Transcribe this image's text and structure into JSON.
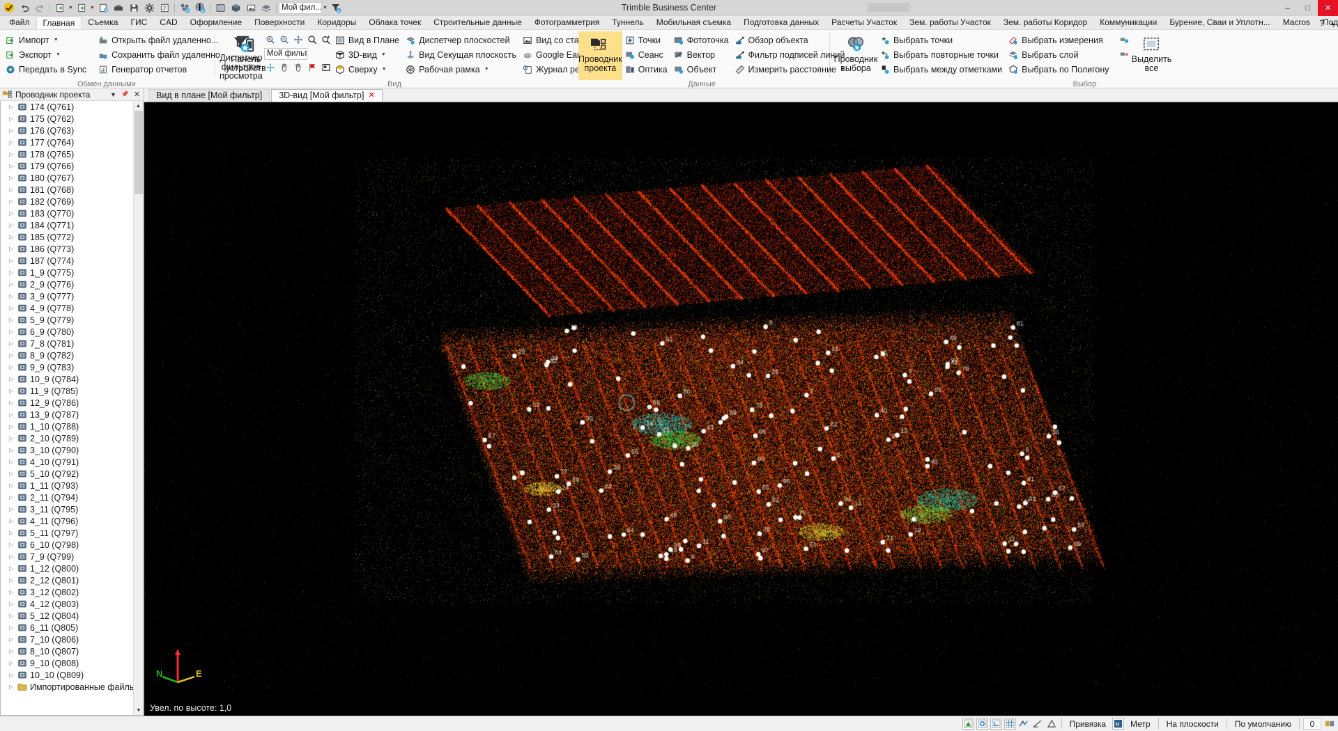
{
  "window": {
    "title": "Trimble Business Center",
    "minimize": "–",
    "maximize": "□",
    "close": "✕"
  },
  "quick_access": {
    "filter_value": "Мой фил...",
    "icons": [
      "trimble-logo-icon",
      "undo-icon",
      "redo-icon",
      "new-project-icon",
      "open-project-icon",
      "save-as-icon",
      "import-icon",
      "save-icon",
      "settings-icon",
      "report-icon",
      "network-icon",
      "globe-icon",
      "window-icon",
      "cube-icon",
      "image-icon",
      "layer-icon"
    ]
  },
  "tabs": {
    "items": [
      {
        "label": "Файл",
        "active": false
      },
      {
        "label": "Главная",
        "active": true
      },
      {
        "label": "Съемка",
        "active": false
      },
      {
        "label": "ГИС",
        "active": false
      },
      {
        "label": "CAD",
        "active": false
      },
      {
        "label": "Оформление",
        "active": false
      },
      {
        "label": "Поверхности",
        "active": false
      },
      {
        "label": "Коридоры",
        "active": false
      },
      {
        "label": "Облака точек",
        "active": false
      },
      {
        "label": "Строительные данные",
        "active": false
      },
      {
        "label": "Фотограмметрия",
        "active": false
      },
      {
        "label": "Туннель",
        "active": false
      },
      {
        "label": "Мобильная съемка",
        "active": false
      },
      {
        "label": "Подготовка данных",
        "active": false
      },
      {
        "label": "Расчеты Участок",
        "active": false
      },
      {
        "label": "Зем. работы Участок",
        "active": false
      },
      {
        "label": "Зем. работы Коридор",
        "active": false
      },
      {
        "label": "Коммуникации",
        "active": false
      },
      {
        "label": "Бурение, Сваи и Уплотн...",
        "active": false
      },
      {
        "label": "Macros",
        "active": false
      },
      {
        "label": "Поддержка",
        "active": false
      }
    ],
    "help_icon": "question-icon",
    "collapse_icon": "chevron-up-icon"
  },
  "ribbon": {
    "groups": [
      {
        "title": "Обмен данными",
        "columns": [
          {
            "items": [
              {
                "label": "Импорт",
                "icon": "import-icon",
                "dropdown": true
              },
              {
                "label": "Экспорт",
                "icon": "export-icon",
                "dropdown": true
              },
              {
                "label": "Передать в Sync",
                "icon": "sync-icon",
                "dropdown": false
              }
            ]
          },
          {
            "items": [
              {
                "label": "Открыть файл удаленно...",
                "icon": "open-remote-icon",
                "dropdown": false
              },
              {
                "label": "Сохранить файл удаленно",
                "icon": "save-remote-icon",
                "dropdown": false
              },
              {
                "label": "Генератор отчетов",
                "icon": "report-generator-icon",
                "dropdown": false
              }
            ]
          }
        ],
        "big_buttons": [
          {
            "label": "Панель устройств",
            "icon": "devices-panel-icon",
            "selected": false
          }
        ]
      },
      {
        "title": "Вид",
        "big_buttons": [
          {
            "label": "Диспетчер фильтров просмотра",
            "icon": "view-filter-manager-icon",
            "selected": false,
            "wide": true
          }
        ],
        "view_tools_row1": [
          "zoom-in-icon",
          "zoom-out-icon",
          "zoom-extents-icon",
          "zoom-window-icon",
          "zoom-selected-icon"
        ],
        "filter_select": {
          "value": "Мой фильтр",
          "icon": "chevron-down-icon"
        },
        "view_tools_row3": [
          "pan-dynamic-icon",
          "pan-hand-icon",
          "orbit-icon",
          "flag-icon",
          "named-view-icon"
        ],
        "columns": [
          {
            "items": [
              {
                "label": "Вид в Плане",
                "icon": "plan-view-icon",
                "dropdown": false
              },
              {
                "label": "3D-вид",
                "icon": "3d-view-icon",
                "dropdown": true
              },
              {
                "label": "Сверху",
                "icon": "top-view-icon",
                "dropdown": true
              }
            ]
          },
          {
            "items": [
              {
                "label": "Диспетчер плоскостей",
                "icon": "plane-manager-icon",
                "dropdown": false
              },
              {
                "label": "Вид Секущая плоскость",
                "icon": "section-view-icon",
                "dropdown": false
              },
              {
                "label": "Рабочая рамка",
                "icon": "work-frame-icon",
                "dropdown": true
              }
            ]
          },
          {
            "items": [
              {
                "label": "Вид со станции",
                "icon": "station-view-icon",
                "dropdown": false
              },
              {
                "label": "Google Earth",
                "icon": "google-earth-icon",
                "dropdown": false
              },
              {
                "label": "Журнал регистрации",
                "icon": "registration-log-icon",
                "dropdown": false
              }
            ]
          }
        ]
      },
      {
        "title": "Данные",
        "big_buttons": [
          {
            "label": "Проводник проекта",
            "icon": "project-explorer-icon",
            "selected": true
          }
        ],
        "columns": [
          {
            "items": [
              {
                "label": "Точки",
                "icon": "points-icon",
                "dropdown": false
              },
              {
                "label": "Сеанс",
                "icon": "session-icon",
                "dropdown": false
              },
              {
                "label": "Оптика",
                "icon": "optics-icon",
                "dropdown": false
              }
            ]
          },
          {
            "items": [
              {
                "label": "Фототочка",
                "icon": "photo-point-icon",
                "dropdown": false
              },
              {
                "label": "Вектор",
                "icon": "vector-icon",
                "dropdown": false
              },
              {
                "label": "Объект",
                "icon": "object-icon",
                "dropdown": false
              }
            ]
          },
          {
            "items": [
              {
                "label": "Обзор объекта",
                "icon": "object-review-icon",
                "dropdown": false
              },
              {
                "label": "Фильтр подписей линий",
                "icon": "line-label-filter-icon",
                "dropdown": false
              },
              {
                "label": "Измерить расстояние",
                "icon": "measure-distance-icon",
                "dropdown": true
              }
            ]
          }
        ]
      },
      {
        "title": "Выбор",
        "big_buttons": [
          {
            "label": "Проводник выбора",
            "icon": "selection-explorer-icon",
            "selected": false
          }
        ],
        "columns": [
          {
            "items": [
              {
                "label": "Выбрать точки",
                "icon": "select-points-icon",
                "dropdown": false
              },
              {
                "label": "Выбрать повторные точки",
                "icon": "select-duplicate-points-icon",
                "dropdown": false
              },
              {
                "label": "Выбрать между отметками",
                "icon": "select-between-marks-icon",
                "dropdown": false
              }
            ]
          },
          {
            "items": [
              {
                "label": "Выбрать измерения",
                "icon": "select-measurements-icon",
                "dropdown": false
              },
              {
                "label": "Выбрать слой",
                "icon": "select-layer-icon",
                "dropdown": false
              },
              {
                "label": "Выбрать по Полигону",
                "icon": "select-by-polygon-icon",
                "dropdown": false
              }
            ]
          }
        ],
        "tail_buttons": [
          {
            "label": "Выделить все",
            "icon": "select-all-icon"
          }
        ],
        "tail_small_icons": [
          "select-group1-icon",
          "select-group2-icon"
        ]
      }
    ]
  },
  "sidebar": {
    "panel_title": "Проводник проекта",
    "dropdown_icon": "chevron-down-icon",
    "pin_icon": "pin-icon",
    "close_icon": "close-icon",
    "panel_icon": "project-explorer-icon",
    "tree_items": [
      {
        "label": "174 (Q761)",
        "icon": "scan-station-icon"
      },
      {
        "label": "175 (Q762)",
        "icon": "scan-station-icon"
      },
      {
        "label": "176 (Q763)",
        "icon": "scan-station-icon"
      },
      {
        "label": "177 (Q764)",
        "icon": "scan-station-icon"
      },
      {
        "label": "178 (Q765)",
        "icon": "scan-station-icon"
      },
      {
        "label": "179 (Q766)",
        "icon": "scan-station-icon"
      },
      {
        "label": "180 (Q767)",
        "icon": "scan-station-icon"
      },
      {
        "label": "181 (Q768)",
        "icon": "scan-station-icon"
      },
      {
        "label": "182 (Q769)",
        "icon": "scan-station-icon"
      },
      {
        "label": "183 (Q770)",
        "icon": "scan-station-icon"
      },
      {
        "label": "184 (Q771)",
        "icon": "scan-station-icon"
      },
      {
        "label": "185 (Q772)",
        "icon": "scan-station-icon"
      },
      {
        "label": "186 (Q773)",
        "icon": "scan-station-icon"
      },
      {
        "label": "187 (Q774)",
        "icon": "scan-station-icon"
      },
      {
        "label": "1_9 (Q775)",
        "icon": "scan-station-icon"
      },
      {
        "label": "2_9 (Q776)",
        "icon": "scan-station-icon"
      },
      {
        "label": "3_9 (Q777)",
        "icon": "scan-station-icon"
      },
      {
        "label": "4_9 (Q778)",
        "icon": "scan-station-icon"
      },
      {
        "label": "5_9 (Q779)",
        "icon": "scan-station-icon"
      },
      {
        "label": "6_9 (Q780)",
        "icon": "scan-station-icon"
      },
      {
        "label": "7_8 (Q781)",
        "icon": "scan-station-icon"
      },
      {
        "label": "8_9 (Q782)",
        "icon": "scan-station-icon"
      },
      {
        "label": "9_9 (Q783)",
        "icon": "scan-station-icon"
      },
      {
        "label": "10_9 (Q784)",
        "icon": "scan-station-icon"
      },
      {
        "label": "11_9 (Q785)",
        "icon": "scan-station-icon"
      },
      {
        "label": "12_9 (Q786)",
        "icon": "scan-station-icon"
      },
      {
        "label": "13_9 (Q787)",
        "icon": "scan-station-icon"
      },
      {
        "label": "1_10 (Q788)",
        "icon": "scan-station-icon"
      },
      {
        "label": "2_10 (Q789)",
        "icon": "scan-station-icon"
      },
      {
        "label": "3_10 (Q790)",
        "icon": "scan-station-icon"
      },
      {
        "label": "4_10 (Q791)",
        "icon": "scan-station-icon"
      },
      {
        "label": "5_10 (Q792)",
        "icon": "scan-station-icon"
      },
      {
        "label": "1_11 (Q793)",
        "icon": "scan-station-icon"
      },
      {
        "label": "2_11 (Q794)",
        "icon": "scan-station-icon"
      },
      {
        "label": "3_11 (Q795)",
        "icon": "scan-station-icon"
      },
      {
        "label": "4_11 (Q796)",
        "icon": "scan-station-icon"
      },
      {
        "label": "5_11 (Q797)",
        "icon": "scan-station-icon"
      },
      {
        "label": "6_10 (Q798)",
        "icon": "scan-station-icon"
      },
      {
        "label": "7_9 (Q799)",
        "icon": "scan-station-icon"
      },
      {
        "label": "1_12 (Q800)",
        "icon": "scan-station-icon"
      },
      {
        "label": "2_12 (Q801)",
        "icon": "scan-station-icon"
      },
      {
        "label": "3_12 (Q802)",
        "icon": "scan-station-icon"
      },
      {
        "label": "4_12 (Q803)",
        "icon": "scan-station-icon"
      },
      {
        "label": "5_12 (Q804)",
        "icon": "scan-station-icon"
      },
      {
        "label": "6_11 (Q805)",
        "icon": "scan-station-icon"
      },
      {
        "label": "7_10 (Q806)",
        "icon": "scan-station-icon"
      },
      {
        "label": "8_10 (Q807)",
        "icon": "scan-station-icon"
      },
      {
        "label": "9_10 (Q808)",
        "icon": "scan-station-icon"
      },
      {
        "label": "10_10 (Q809)",
        "icon": "scan-station-icon"
      },
      {
        "label": "Импортированные файлы",
        "icon": "folder-icon"
      }
    ]
  },
  "document_tabs": [
    {
      "label": "Вид в плане [Мой фильтр]",
      "active": false,
      "closable": false
    },
    {
      "label": "3D-вид [Мой фильтр]",
      "active": true,
      "closable": true,
      "close_icon": "close-icon"
    }
  ],
  "viewport": {
    "status_text": "Увел. по высоте: 1,0",
    "axis": {
      "north_label": "N",
      "east_label": "E",
      "z_color": "#ff2a2a",
      "n_color": "#21b421",
      "e_color": "#d8c022"
    },
    "background_color": "#000000",
    "point_cloud_palette": [
      "#ff2d00",
      "#ff6a00",
      "#ffb300",
      "#ffe600",
      "#8bd400",
      "#00c8a0",
      "#0077ff",
      "#ffffff"
    ]
  },
  "statusbar": {
    "left": "",
    "icons": [
      "snap-grid-icon",
      "snap-point-icon",
      "snap-ortho-icon",
      "grid-icon",
      "osnap-icon",
      "polar-icon",
      "dynamic-input-icon"
    ],
    "items": [
      {
        "label": "Привязка",
        "icon": "snap-icon"
      },
      {
        "label": "Метр",
        "icon": "units-icon"
      },
      {
        "label": "На плоскости",
        "icon": null
      },
      {
        "label": "По умолчанию",
        "icon": null
      }
    ],
    "counter": "0",
    "end_icon": "view-toggle-icon"
  }
}
